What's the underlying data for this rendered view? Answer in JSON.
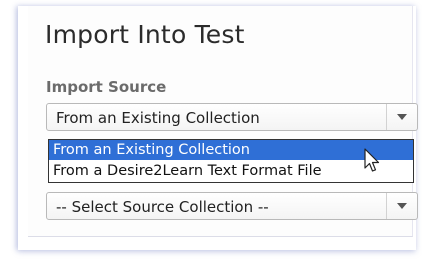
{
  "dialog": {
    "title": "Import Into Test",
    "section_label": "Import Source"
  },
  "import_source": {
    "selected_value": "From an Existing Collection",
    "options": [
      "From an Existing Collection",
      "From a Desire2Learn Text Format File"
    ],
    "highlighted_option_index": 0
  },
  "source_collection": {
    "selected_value": "-- Select Source Collection --"
  },
  "icons": {
    "dropdown_arrow": "chevron-down-icon",
    "pointer": "mouse-pointer-icon"
  },
  "colors": {
    "highlight": "#2f6fd6",
    "panel_glow": "#9aa4d8"
  }
}
